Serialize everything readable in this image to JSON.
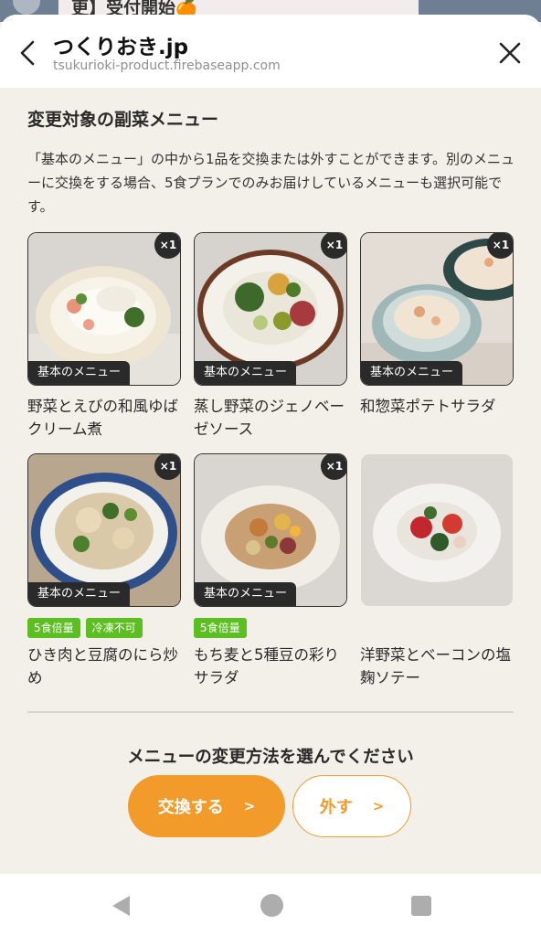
{
  "background": {
    "banner_text": "更】受付開始🍊"
  },
  "browser": {
    "title": "つくりおき.jp",
    "url": "tsukurioki-product.firebaseapp.com"
  },
  "section": {
    "title": "変更対象の副菜メニュー",
    "description": "「基本のメニュー」の中から1品を交換または外すことができます。別のメニューに交換をする場合、5食プランでのみお届けしているメニューも選択可能です。"
  },
  "menu_items": [
    {
      "name": "野菜とえびの和風ゆばクリーム煮",
      "qty": "×1",
      "tag": "基本のメニュー",
      "badges": []
    },
    {
      "name": "蒸し野菜のジェノベーゼソース",
      "qty": "×1",
      "tag": "基本のメニュー",
      "badges": []
    },
    {
      "name": "和惣菜ポテトサラダ",
      "qty": "×1",
      "tag": "基本のメニュー",
      "badges": []
    },
    {
      "name": "ひき肉と豆腐のにら炒め",
      "qty": "×1",
      "tag": "基本のメニュー",
      "badges": [
        "5食倍量",
        "冷凍不可"
      ]
    },
    {
      "name": "もち麦と5種豆の彩りサラダ",
      "qty": "×1",
      "tag": "基本のメニュー",
      "badges": [
        "5食倍量"
      ]
    },
    {
      "name": "洋野菜とベーコンの塩麹ソテー",
      "qty": "",
      "tag": "",
      "badges": []
    }
  ],
  "actions": {
    "prompt": "メニューの変更方法を選んでください",
    "exchange_label": "交換する",
    "remove_label": "外す",
    "chevron": ">"
  },
  "colors": {
    "accent": "#f29b2a",
    "badge_green": "#5bbf21",
    "tag_dark": "#2a2a2a",
    "sheet_bg": "#f3efe9"
  }
}
